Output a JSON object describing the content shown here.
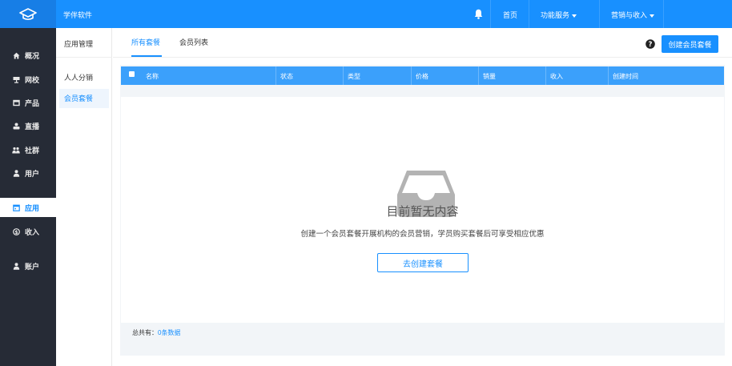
{
  "topbar": {
    "brand": "学伴软件",
    "nav": {
      "home": "首页",
      "features": "功能服务",
      "marketing": "营销与收入"
    }
  },
  "sidebar": {
    "items": [
      {
        "label": "概况",
        "icon": "home-icon"
      },
      {
        "label": "网校",
        "icon": "school-icon"
      },
      {
        "label": "产品",
        "icon": "product-icon"
      },
      {
        "label": "直播",
        "icon": "live-icon"
      },
      {
        "label": "社群",
        "icon": "community-icon"
      },
      {
        "label": "用户",
        "icon": "user-icon"
      },
      {
        "label": "应用",
        "icon": "app-icon"
      },
      {
        "label": "收入",
        "icon": "income-icon"
      },
      {
        "label": "账户",
        "icon": "account-icon"
      }
    ],
    "active": "应用"
  },
  "subnav": {
    "title": "应用管理",
    "items": [
      "人人分销",
      "会员套餐"
    ],
    "active": "会员套餐"
  },
  "main": {
    "tabs": [
      "所有套餐",
      "会员列表"
    ],
    "active_tab": "所有套餐",
    "create_button": "创建会员套餐",
    "table": {
      "columns": [
        "名称",
        "状态",
        "类型",
        "价格",
        "销量",
        "收入",
        "创建时间"
      ]
    },
    "empty": {
      "title": "目前暂无内容",
      "description": "创建一个会员套餐开展机构的会员营销，学员购买套餐后可享受相应优惠",
      "button": "去创建套餐"
    },
    "footer": {
      "label": "总共有：",
      "count": "0条数据"
    }
  },
  "colors": {
    "primary": "#1890ff",
    "sidebar_bg": "#262b36",
    "table_header": "#3ba0fb"
  }
}
